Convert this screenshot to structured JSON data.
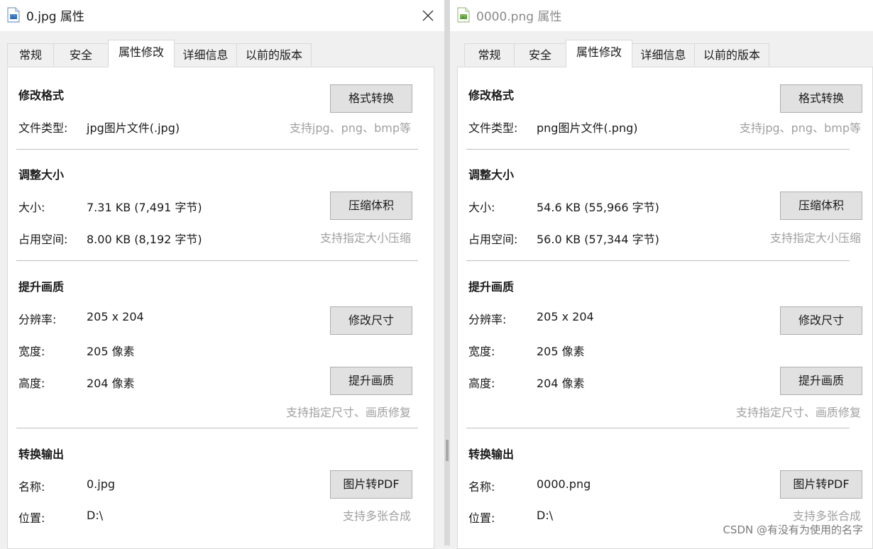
{
  "left_window": {
    "title": "0.jpg 属性",
    "tabs": [
      "常规",
      "安全",
      "属性修改",
      "详细信息",
      "以前的版本"
    ],
    "active_tab": "属性修改",
    "format": {
      "section_title": "修改格式",
      "file_type_label": "文件类型:",
      "file_type_value": "jpg图片文件(.jpg)",
      "convert_button": "格式转换",
      "hint": "支持jpg、png、bmp等"
    },
    "resize": {
      "section_title": "调整大小",
      "size_label": "大小:",
      "size_value": "7.31 KB (7,491 字节)",
      "disk_label": "占用空间:",
      "disk_value": "8.00 KB (8,192 字节)",
      "compress_button": "压缩体积",
      "hint": "支持指定大小压缩"
    },
    "quality": {
      "section_title": "提升画质",
      "resolution_label": "分辨率:",
      "resolution_value": "205 x 204",
      "width_label": "宽度:",
      "width_value": "205 像素",
      "height_label": "高度:",
      "height_value": "204 像素",
      "resize_button": "修改尺寸",
      "enhance_button": "提升画质",
      "hint": "支持指定尺寸、画质修复"
    },
    "output": {
      "section_title": "转换输出",
      "name_label": "名称:",
      "name_value": "0.jpg",
      "location_label": "位置:",
      "location_value": "D:\\",
      "pdf_button": "图片转PDF",
      "hint": "支持多张合成"
    }
  },
  "right_window": {
    "title": "0000.png 属性",
    "tabs": [
      "常规",
      "安全",
      "属性修改",
      "详细信息",
      "以前的版本"
    ],
    "active_tab": "属性修改",
    "format": {
      "section_title": "修改格式",
      "file_type_label": "文件类型:",
      "file_type_value": "png图片文件(.png)",
      "convert_button": "格式转换",
      "hint": "支持jpg、png、bmp等"
    },
    "resize": {
      "section_title": "调整大小",
      "size_label": "大小:",
      "size_value": "54.6 KB (55,966 字节)",
      "disk_label": "占用空间:",
      "disk_value": "56.0 KB (57,344 字节)",
      "compress_button": "压缩体积",
      "hint": "支持指定大小压缩"
    },
    "quality": {
      "section_title": "提升画质",
      "resolution_label": "分辨率:",
      "resolution_value": "205 x 204",
      "width_label": "宽度:",
      "width_value": "205 像素",
      "height_label": "高度:",
      "height_value": "204 像素",
      "resize_button": "修改尺寸",
      "enhance_button": "提升画质",
      "hint": "支持指定尺寸、画质修复"
    },
    "output": {
      "section_title": "转换输出",
      "name_label": "名称:",
      "name_value": "0000.png",
      "location_label": "位置:",
      "location_value": "D:\\",
      "pdf_button": "图片转PDF",
      "hint": "支持多张合成"
    }
  },
  "watermark": "CSDN @有没有为使用的名字",
  "icons": {
    "left_file_icon": "image-file-icon",
    "right_file_icon": "image-file-icon",
    "close_icon": "close-icon"
  },
  "colors": {
    "hint_text": "#a0a0a0",
    "button_bg": "#e1e1e1",
    "panel_bg": "#ffffff",
    "window_bg": "#f0f0f0"
  }
}
